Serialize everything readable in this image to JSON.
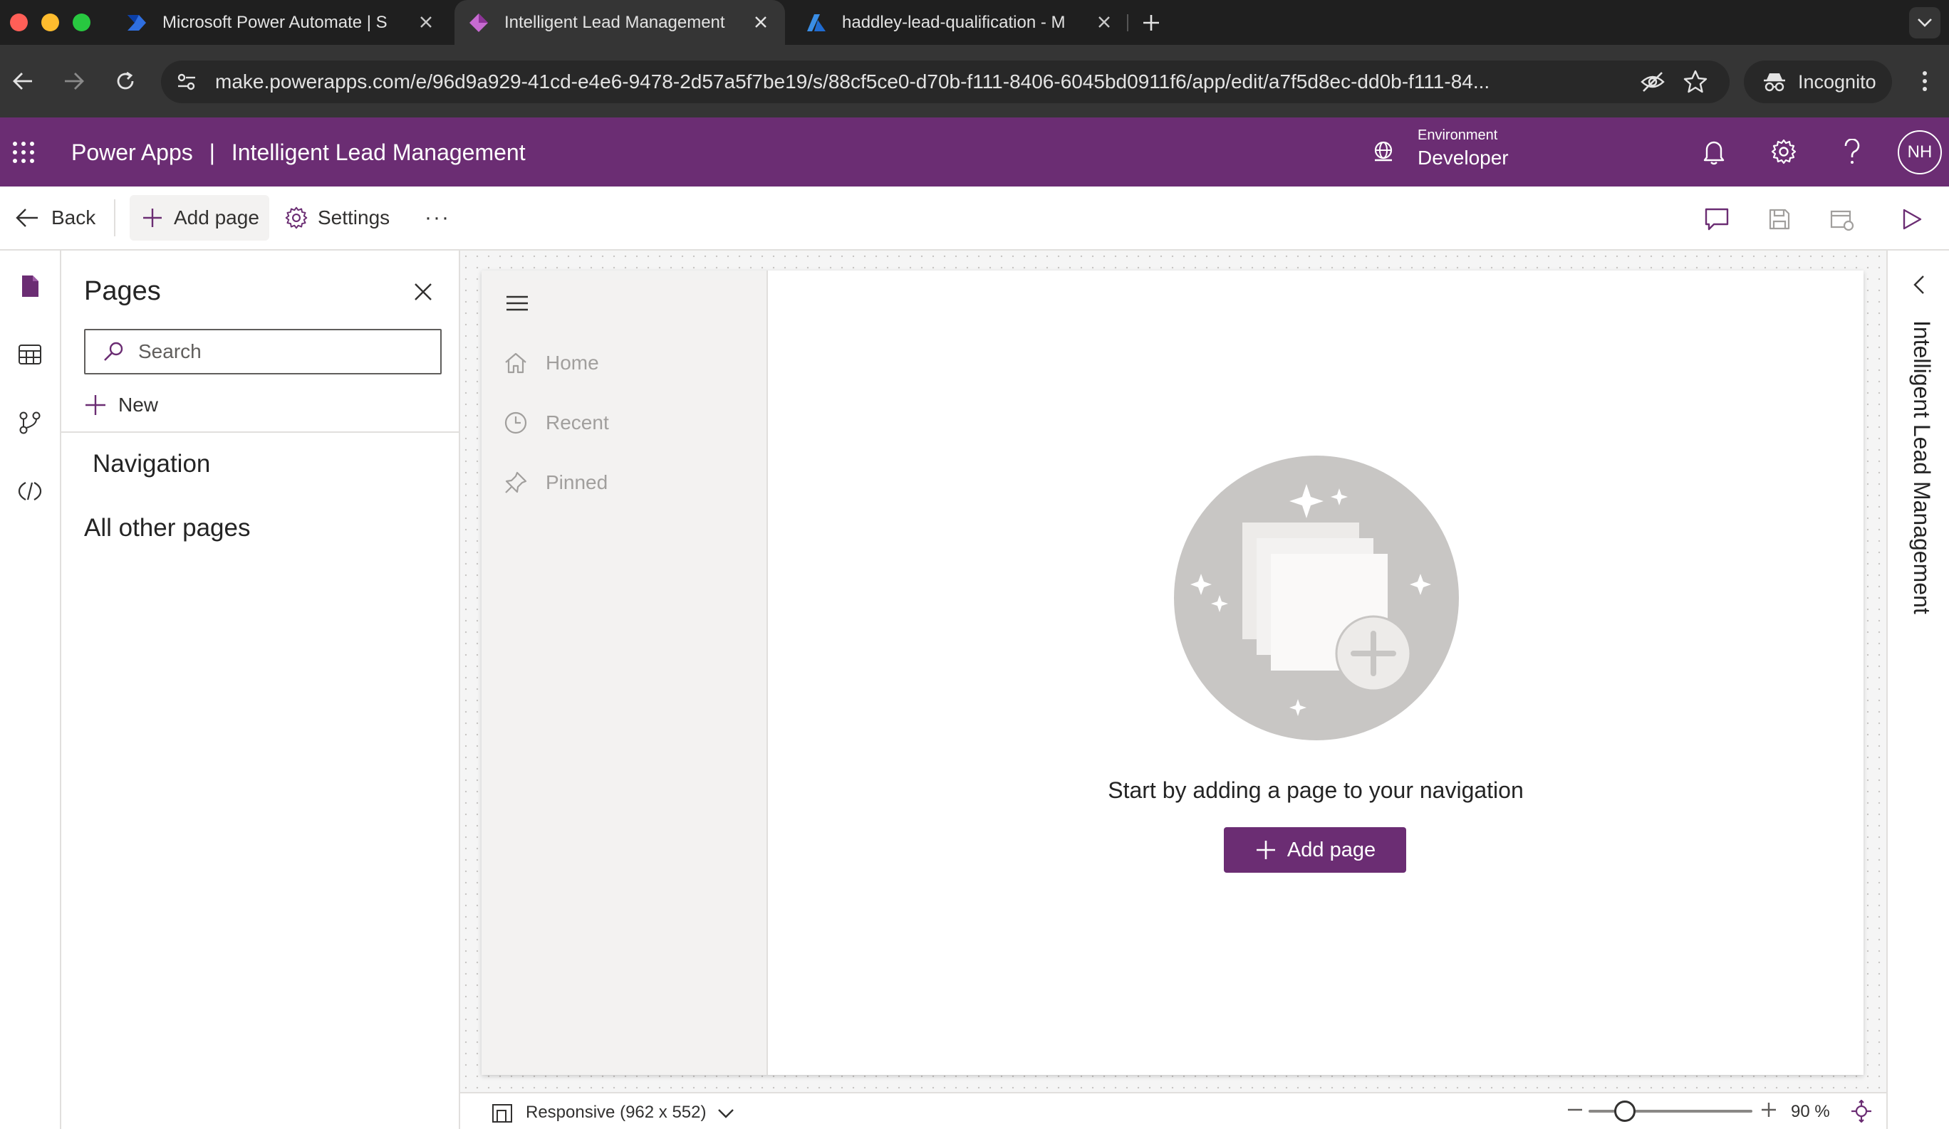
{
  "browser": {
    "tabs": [
      {
        "title": "Microsoft Power Automate | S",
        "active": false
      },
      {
        "title": "Intelligent Lead Management",
        "active": true
      },
      {
        "title": "haddley-lead-qualification - M",
        "active": false
      }
    ],
    "url": "make.powerapps.com/e/96d9a929-41cd-e4e6-9478-2d57a5f7be19/s/88cf5ce0-d70b-f111-8406-6045bd0911f6/app/edit/a7f5d8ec-dd0b-f111-84...",
    "incognito_label": "Incognito"
  },
  "header": {
    "product": "Power Apps",
    "separator": "|",
    "app_name": "Intelligent Lead Management",
    "environment_label": "Environment",
    "environment_value": "Developer",
    "avatar_initials": "NH",
    "brand_color": "#6b2d73"
  },
  "commandbar": {
    "back_label": "Back",
    "add_page_label": "Add page",
    "settings_label": "Settings",
    "more_label": "···"
  },
  "pages_pane": {
    "title": "Pages",
    "search_placeholder": "Search",
    "new_label": "New",
    "navigation_heading": "Navigation",
    "other_pages_heading": "All other pages"
  },
  "app_preview": {
    "nav_items": [
      {
        "label": "Home",
        "icon": "home-icon"
      },
      {
        "label": "Recent",
        "icon": "clock-icon"
      },
      {
        "label": "Pinned",
        "icon": "pin-icon"
      }
    ],
    "empty_message": "Start by adding a page to your navigation",
    "add_page_button": "Add page"
  },
  "statusbar": {
    "responsive_label": "Responsive (962 x 552)",
    "zoom_label": "90 %",
    "zoom_fraction": 0.18
  },
  "right_panel": {
    "title": "Intelligent Lead Management"
  }
}
